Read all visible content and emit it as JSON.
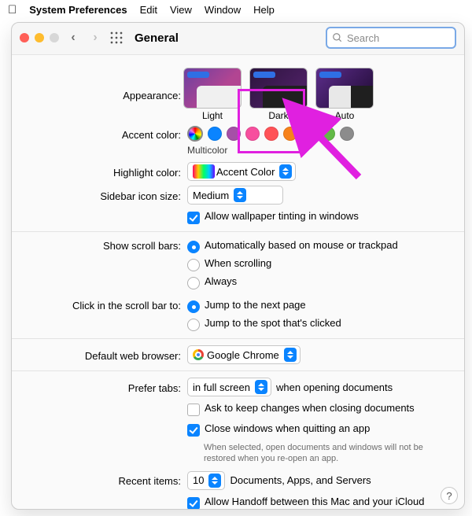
{
  "menubar": {
    "app": "System Preferences",
    "items": [
      "Edit",
      "View",
      "Window",
      "Help"
    ]
  },
  "window": {
    "title": "General",
    "search_placeholder": "Search"
  },
  "appearance": {
    "label": "Appearance:",
    "options": [
      "Light",
      "Dark",
      "Auto"
    ],
    "selected": "Dark"
  },
  "accent": {
    "label": "Accent color:",
    "caption": "Multicolor",
    "colors": [
      "multicolor",
      "#0a84ff",
      "#a550a7",
      "#f74f9e",
      "#ff5257",
      "#f7821b",
      "#ffc600",
      "#62ba46",
      "#8c8c8c"
    ]
  },
  "highlight": {
    "label": "Highlight color:",
    "value": "Accent Color"
  },
  "sidebar": {
    "label": "Sidebar icon size:",
    "value": "Medium"
  },
  "wallpaper_tint": {
    "label": "Allow wallpaper tinting in windows",
    "checked": true
  },
  "scrollbars": {
    "label": "Show scroll bars:",
    "options": [
      "Automatically based on mouse or trackpad",
      "When scrolling",
      "Always"
    ],
    "selected": 0
  },
  "scrollclick": {
    "label": "Click in the scroll bar to:",
    "options": [
      "Jump to the next page",
      "Jump to the spot that's clicked"
    ],
    "selected": 0
  },
  "browser": {
    "label": "Default web browser:",
    "value": "Google Chrome"
  },
  "tabs": {
    "label": "Prefer tabs:",
    "value": "in full screen",
    "suffix": "when opening documents"
  },
  "ask_changes": {
    "label": "Ask to keep changes when closing documents",
    "checked": false
  },
  "close_windows": {
    "label": "Close windows when quitting an app",
    "checked": true,
    "help": "When selected, open documents and windows will not be restored when you re-open an app."
  },
  "recent": {
    "label": "Recent items:",
    "value": "10",
    "suffix": "Documents, Apps, and Servers"
  },
  "handoff": {
    "label": "Allow Handoff between this Mac and your iCloud devices",
    "checked": true
  },
  "help": "?"
}
